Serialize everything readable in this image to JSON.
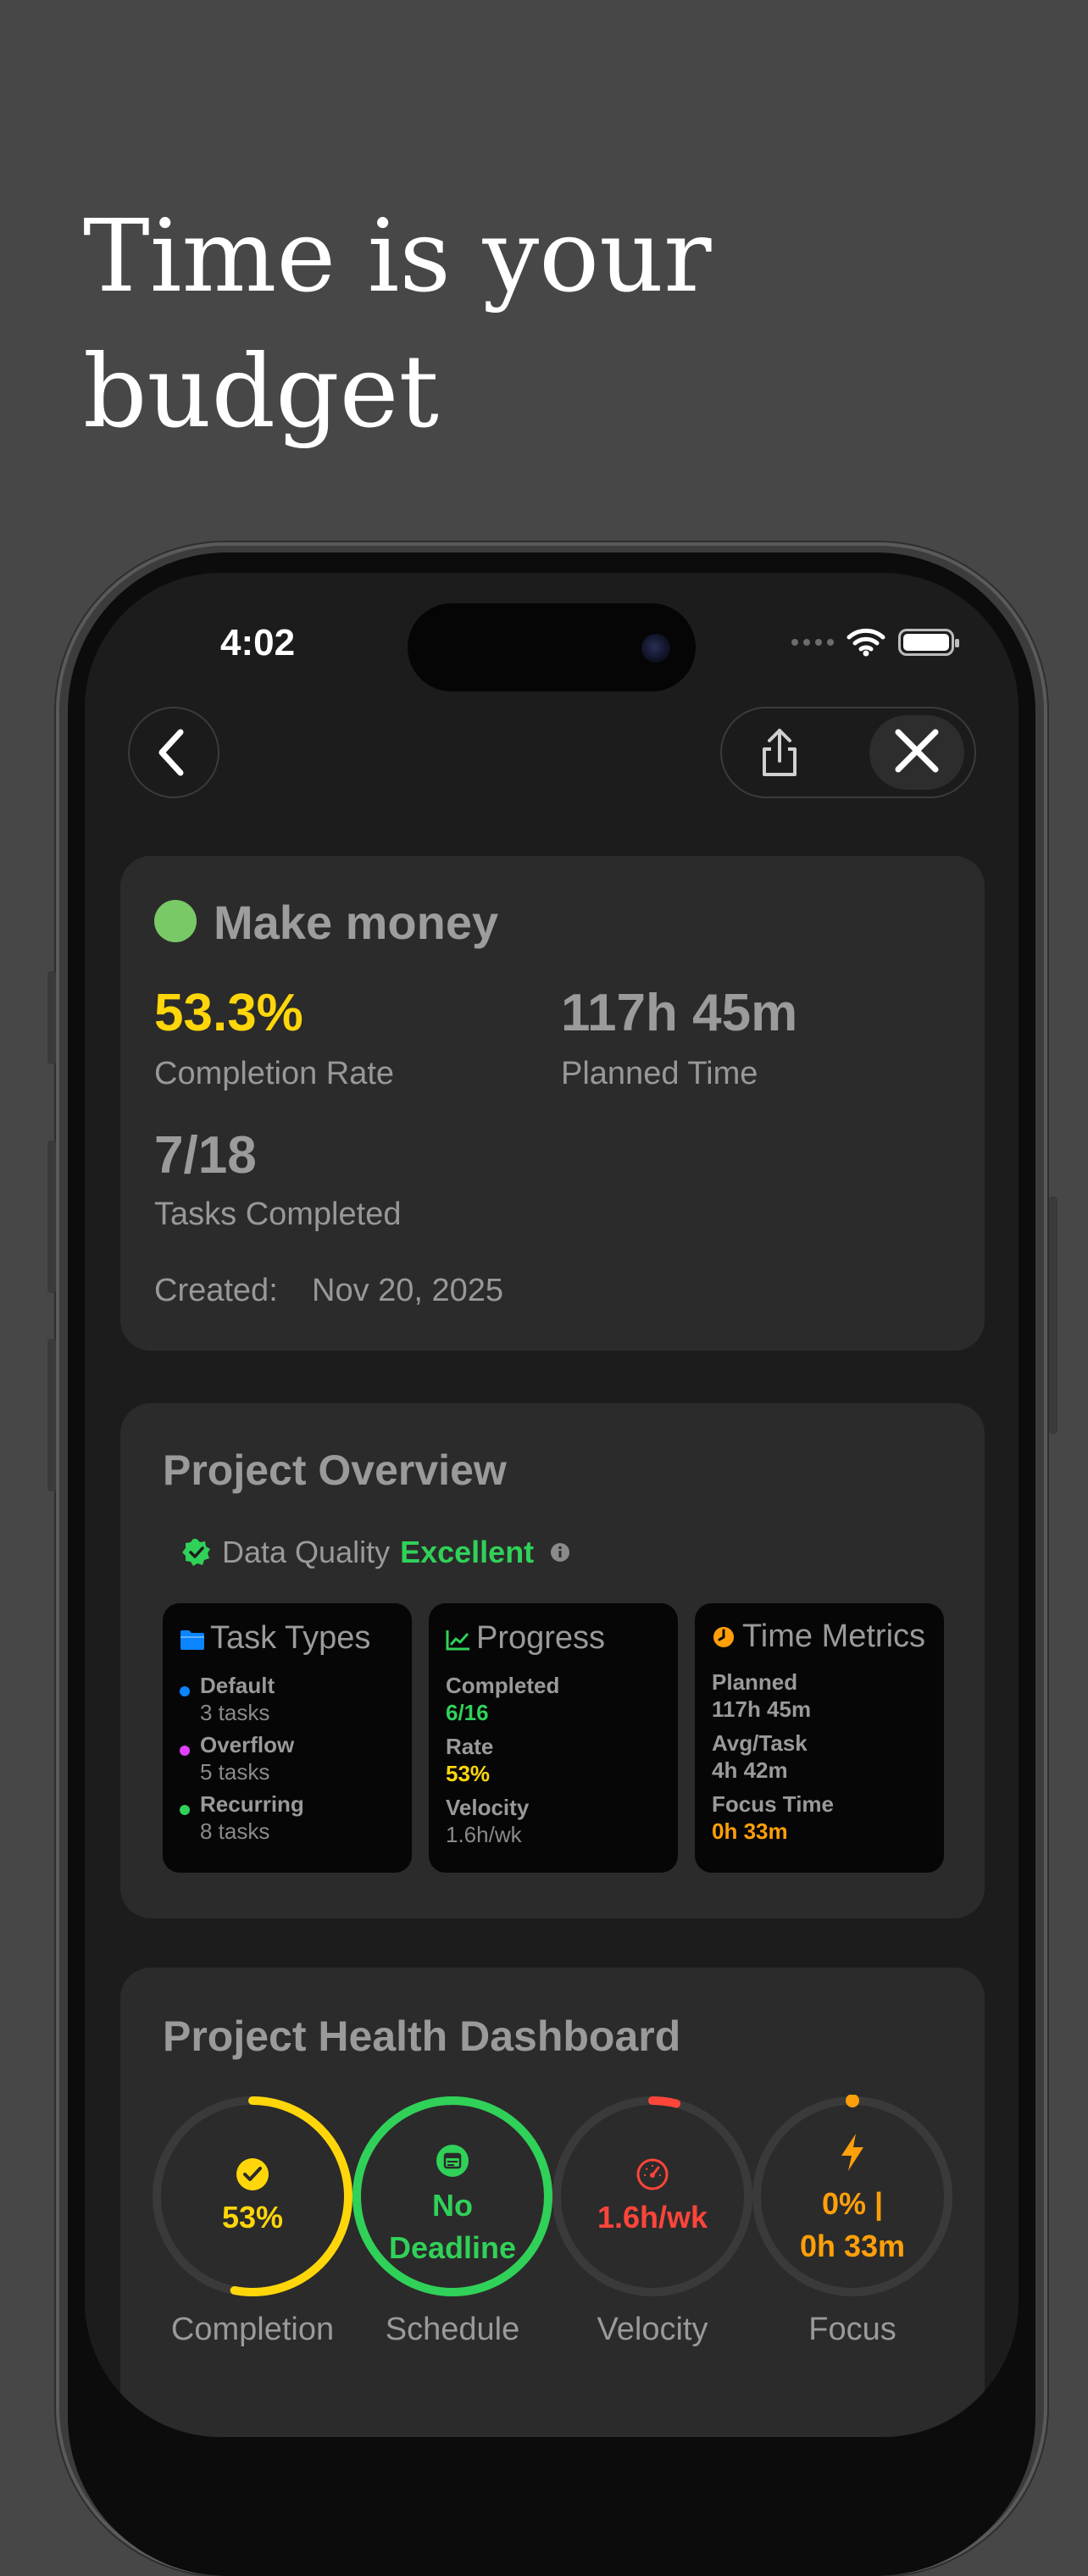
{
  "headline": {
    "line1": "Time is your",
    "line2": "budget"
  },
  "status_bar": {
    "time": "4:02"
  },
  "project": {
    "name": "Make money",
    "completion_rate": "53.3%",
    "completion_rate_label": "Completion Rate",
    "planned_time": "117h 45m",
    "planned_time_label": "Planned Time",
    "tasks_completed": "7/18",
    "tasks_completed_label": "Tasks Completed",
    "created_label": "Created:",
    "created_date": "Nov 20, 2025"
  },
  "overview": {
    "title": "Project Overview",
    "data_quality_label": "Data Quality",
    "data_quality_value": "Excellent",
    "task_types": {
      "title": "Task Types",
      "items": [
        {
          "name": "Default",
          "count": "3 tasks"
        },
        {
          "name": "Overflow",
          "count": "5 tasks"
        },
        {
          "name": "Recurring",
          "count": "8 tasks"
        }
      ]
    },
    "progress": {
      "title": "Progress",
      "completed_label": "Completed",
      "completed_value": "6/16",
      "rate_label": "Rate",
      "rate_value": "53%",
      "velocity_label": "Velocity",
      "velocity_value": "1.6h/wk"
    },
    "time_metrics": {
      "title": "Time Metrics",
      "planned_label": "Planned",
      "planned_value": "117h 45m",
      "avg_label": "Avg/Task",
      "avg_value": "4h 42m",
      "focus_label": "Focus Time",
      "focus_value": "0h 33m"
    }
  },
  "health": {
    "title": "Project Health Dashboard",
    "gauges": [
      {
        "label": "Completion",
        "value": "53%",
        "progress": 0.53,
        "color": "#ffd60a"
      },
      {
        "label": "Schedule",
        "line1": "No",
        "line2": "Deadline",
        "progress": 1.0,
        "color": "#30d158"
      },
      {
        "label": "Velocity",
        "value": "1.6h/wk",
        "progress": 0.04,
        "color": "#ff453a"
      },
      {
        "label": "Focus",
        "line1": "0% |",
        "line2": "0h 33m",
        "progress": 0.0,
        "color": "#ff9f0a"
      }
    ]
  },
  "colors": {
    "completion": "#ffd60a",
    "success": "#30d158",
    "danger": "#ff453a",
    "warning": "#ff9f0a",
    "project_dot": "#79c966",
    "folder_blue": "#0a84ff"
  }
}
